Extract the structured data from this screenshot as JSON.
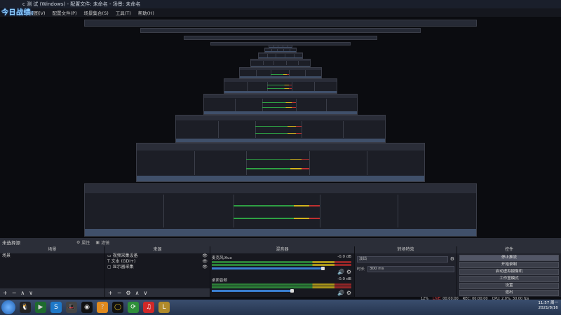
{
  "window": {
    "title": "c 测 试 (Windows) - 配置文件: 未命名 - 场景: 未命名"
  },
  "logo": {
    "text": "今日战绩:"
  },
  "menu": {
    "items": [
      "视图(V)",
      "配置文件(P)",
      "场景集合(S)",
      "工具(T)",
      "帮助(H)"
    ]
  },
  "scene_bar": {
    "name": "未选择源",
    "props_label": "属性",
    "filter_label": "滤镜"
  },
  "panels": {
    "scenes": {
      "title": "场景",
      "items": [
        "场景"
      ]
    },
    "sources": {
      "title": "来源",
      "items": [
        "视频采集设备",
        "文本 (GDI+)",
        "显示器采集"
      ]
    },
    "mixer": {
      "title": "混音器",
      "channels": [
        {
          "name": "麦克风/Aux",
          "db": "-0.0 dB",
          "level": 0.9
        },
        {
          "name": "桌面音频",
          "db": "-0.0 dB",
          "level": 0.9
        }
      ]
    },
    "transitions": {
      "title": "转场特效",
      "select_value": "淡出",
      "duration_label": "时长",
      "duration_value": "300 ms"
    },
    "controls": {
      "title": "控件",
      "buttons": [
        "停止推流",
        "开始录制",
        "启动虚拟摄像机",
        "工作室模式",
        "设置",
        "退出"
      ],
      "active_index": 0
    }
  },
  "status": {
    "live_label": "LIVE:",
    "live_time": "00:00:00",
    "rec_label": "REC:",
    "rec_time": "00:00:00",
    "cpu_label": "CPU: 2.0%, 30.00 fps",
    "clock_time": "11:57 周一",
    "clock_date": "2021/8/16",
    "dropped": "12%"
  },
  "taskbar": {
    "icons": [
      "qq-icon",
      "browser-icon",
      "search-icon",
      "game-icon",
      "obs-icon",
      "folder-icon",
      "ring-icon",
      "app-icon",
      "music-icon",
      "league-icon"
    ]
  }
}
